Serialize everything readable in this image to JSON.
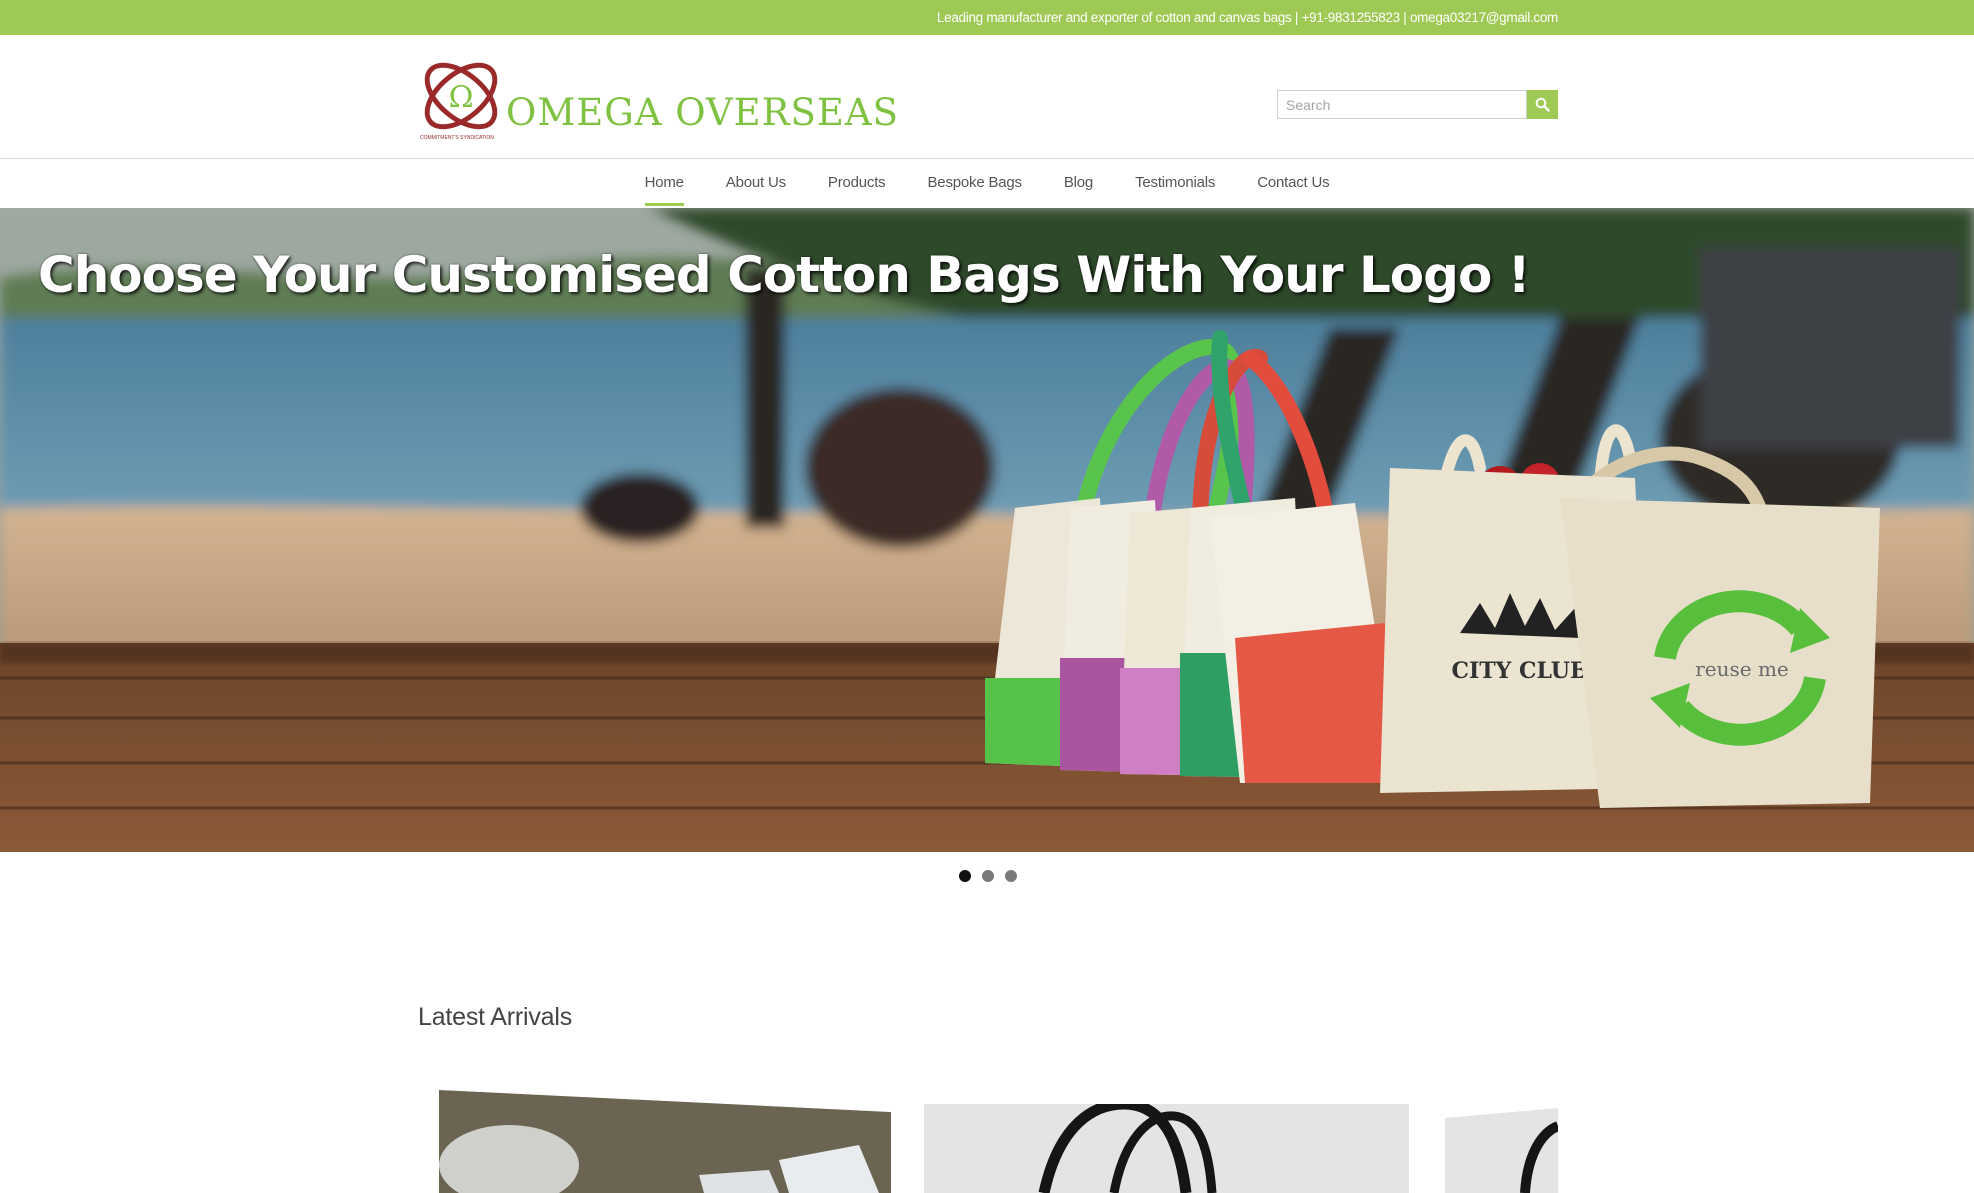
{
  "topbar": {
    "text": "Leading manufacturer and exporter of cotton and canvas bags | +91-9831255823 | omega03217@gmail.com"
  },
  "header": {
    "logo_text": "OMEGA OVERSEAS",
    "logo_tagline": "COMMITMENT'S SYNDICATION",
    "search_placeholder": "Search",
    "search_icon": "search-icon"
  },
  "nav": {
    "items": [
      {
        "label": "Home",
        "active": true
      },
      {
        "label": "About Us"
      },
      {
        "label": "Products"
      },
      {
        "label": "Bespoke Bags"
      },
      {
        "label": "Blog"
      },
      {
        "label": "Testimonials"
      },
      {
        "label": "Contact Us"
      }
    ]
  },
  "hero": {
    "caption": "Choose Your Customised Cotton Bags With Your Logo !",
    "bag_print_left": "CITY CLUB",
    "bag_print_right": "reuse me",
    "slides": 3,
    "active_slide": 1
  },
  "latest": {
    "title": "Latest Arrivals"
  },
  "colors": {
    "accent": "#9fc955",
    "logo_red": "#9a2a2a",
    "logo_green": "#7fc241"
  }
}
